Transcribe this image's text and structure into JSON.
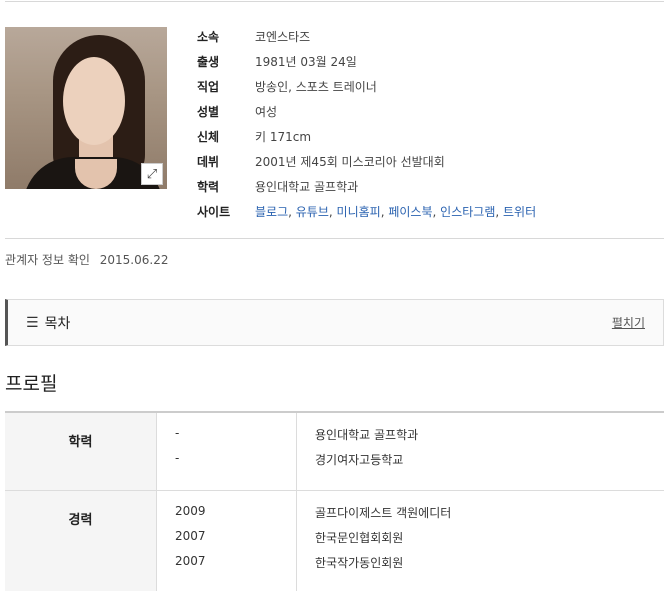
{
  "profile": {
    "fields": [
      {
        "key": "소속",
        "value": "코엔스타즈"
      },
      {
        "key": "출생",
        "value": "1981년 03월 24일"
      },
      {
        "key": "직업",
        "value": "방송인, 스포츠 트레이너"
      },
      {
        "key": "성별",
        "value": "여성"
      },
      {
        "key": "신체",
        "value": "키 171cm"
      },
      {
        "key": "데뷔",
        "value": "2001년 제45회 미스코리아 선발대회"
      },
      {
        "key": "학력",
        "value": "용인대학교 골프학과"
      }
    ],
    "site_key": "사이트",
    "site_links": [
      "블로그",
      "유튜브",
      "미니홈피",
      "페이스북",
      "인스타그램",
      "트위터"
    ],
    "link_color": "#2a62b0"
  },
  "confirm": {
    "label": "관계자 정보 확인",
    "date": "2015.06.22"
  },
  "toc": {
    "title": "목차",
    "expand": "펼치기"
  },
  "section_title": "프로필",
  "table": {
    "education": {
      "label": "학력",
      "rows": [
        {
          "year": "-",
          "text": "용인대학교 골프학과"
        },
        {
          "year": "-",
          "text": "경기여자고등학교"
        }
      ]
    },
    "career": {
      "label": "경력",
      "rows": [
        {
          "year": "2009",
          "text": "골프다이제스트 객원에디터"
        },
        {
          "year": "2007",
          "text": "한국문인협회회원"
        },
        {
          "year": "2007",
          "text": "한국작가동인회원"
        }
      ]
    }
  }
}
